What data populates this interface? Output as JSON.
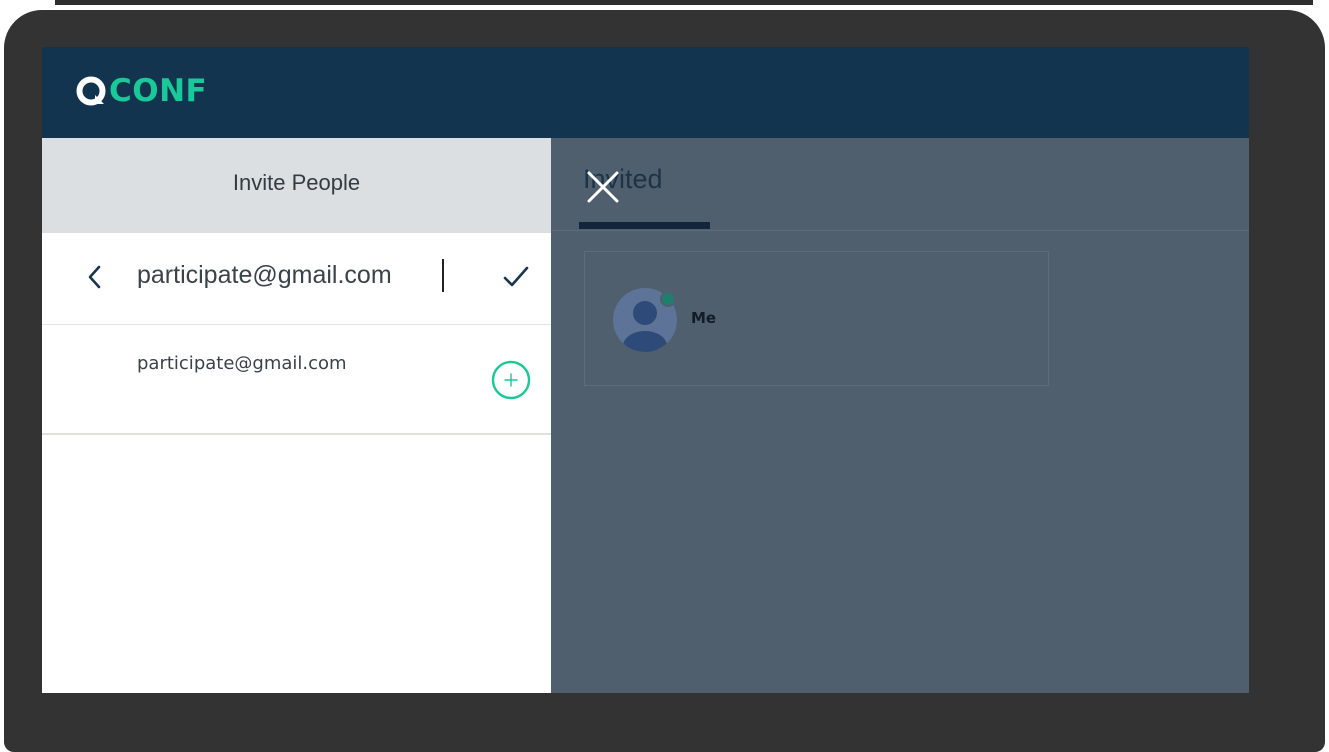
{
  "app": {
    "name": "CONF",
    "logo_icon": "q-logo-icon",
    "brand_color": "#19c99a",
    "header_color": "#12344f"
  },
  "invite_panel": {
    "title": "Invite People",
    "search": {
      "value": "participate@gmail.com",
      "back_icon": "chevron-left-icon",
      "confirm_icon": "checkmark-icon"
    },
    "suggestions": [
      {
        "email": "participate@gmail.com",
        "action_icon": "add-circle-icon"
      }
    ]
  },
  "participants_panel": {
    "tabs": [
      {
        "label": "Invited",
        "active": true
      }
    ],
    "close_icon": "close-icon",
    "participants": [
      {
        "name": "Me",
        "avatar_icon": "user-avatar-icon",
        "status": "online",
        "status_color": "#1f7f6c"
      }
    ]
  }
}
